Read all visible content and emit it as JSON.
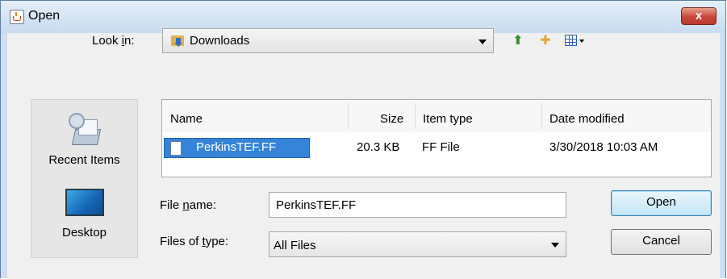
{
  "window": {
    "title": "Open",
    "close_symbol": "x",
    "close_icon": "close-icon",
    "title_icon": "java-cup-icon"
  },
  "lookin": {
    "label_prefix": "Look ",
    "label_mnemonic": "i",
    "label_suffix": "n:",
    "value": "Downloads",
    "value_icon": "downloads-folder-icon"
  },
  "toolbar": {
    "up_icon": "up-folder-icon",
    "new_folder_icon": "new-folder-icon",
    "view_icon": "view-menu-icon"
  },
  "places": [
    {
      "label": "Recent Items",
      "icon": "recent-items-icon"
    },
    {
      "label": "Desktop",
      "icon": "desktop-icon"
    }
  ],
  "columns": {
    "name": "Name",
    "size": "Size",
    "type": "Item type",
    "modified": "Date modified"
  },
  "files": [
    {
      "name": "PerkinsTEF.FF",
      "size": "20.3 KB",
      "type": "FF File",
      "modified": "3/30/2018 10:03 AM",
      "selected": true
    }
  ],
  "filename": {
    "label_prefix": "File ",
    "label_mnemonic": "n",
    "label_suffix": "ame:",
    "value": "PerkinsTEF.FF"
  },
  "filetype": {
    "label_prefix": "Files of ",
    "label_mnemonic": "t",
    "label_suffix": "ype:",
    "value": "All Files"
  },
  "buttons": {
    "open": "Open",
    "cancel": "Cancel"
  },
  "colors": {
    "title_gradient_top": "#e4eef9",
    "selection": "#3584d8",
    "close_button": "#c8463b"
  }
}
